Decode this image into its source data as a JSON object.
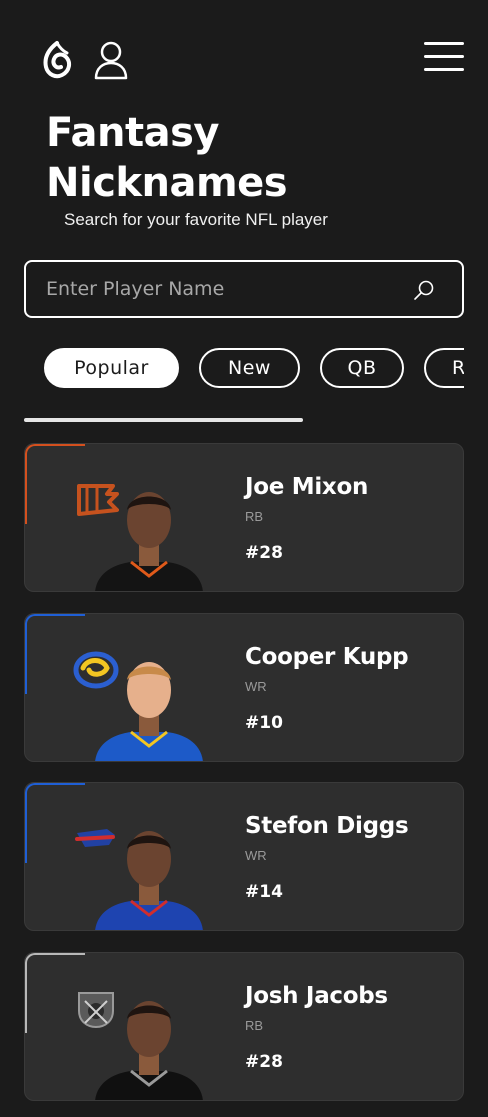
{
  "header": {
    "logo_icon": "brand-logo-icon",
    "user_icon": "user-icon",
    "menu_icon": "hamburger-menu-icon"
  },
  "page": {
    "title": "Fantasy Nicknames",
    "subtitle": "Search for your favorite NFL player"
  },
  "search": {
    "placeholder": "Enter Player Name",
    "value": "",
    "icon": "search-icon"
  },
  "filters": [
    {
      "label": "Popular",
      "active": true
    },
    {
      "label": "New",
      "active": false
    },
    {
      "label": "QB",
      "active": false
    },
    {
      "label": "RB",
      "active": false
    }
  ],
  "players": [
    {
      "name": "Joe Mixon",
      "position": "RB",
      "number": "#28",
      "team": "Bengals",
      "team_logo": "bengals-logo",
      "accent": "#d4501e",
      "jersey": "#141414",
      "trim": "#e05a1a"
    },
    {
      "name": "Cooper Kupp",
      "position": "WR",
      "number": "#10",
      "team": "Rams",
      "team_logo": "rams-logo",
      "accent": "#1f5fd6",
      "jersey": "#1d5ac8",
      "trim": "#f3c622"
    },
    {
      "name": "Stefon Diggs",
      "position": "WR",
      "number": "#14",
      "team": "Bills",
      "team_logo": "bills-logo",
      "accent": "#1f5fd6",
      "jersey": "#1e44b0",
      "trim": "#d12d2d"
    },
    {
      "name": "Josh Jacobs",
      "position": "RB",
      "number": "#28",
      "team": "Raiders",
      "team_logo": "raiders-logo",
      "accent": "#b8b8b8",
      "jersey": "#101010",
      "trim": "#9a9a9a"
    }
  ]
}
